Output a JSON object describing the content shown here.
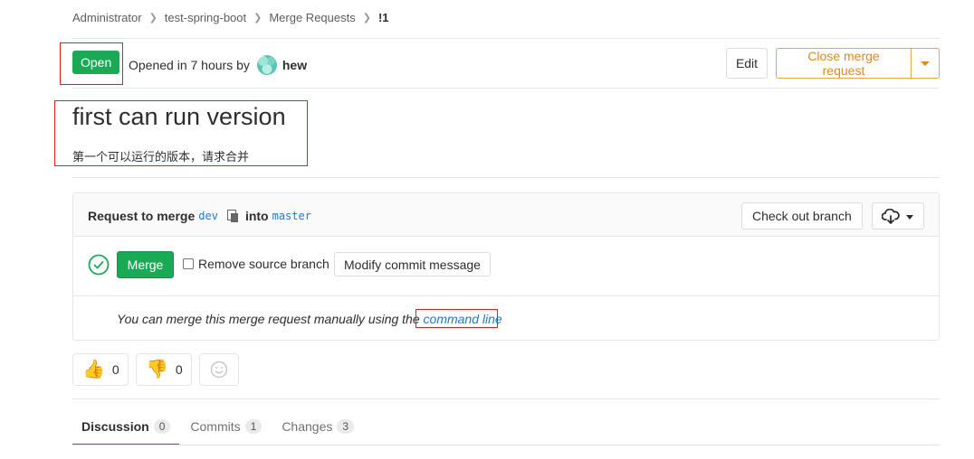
{
  "breadcrumb": [
    "Administrator",
    "test-spring-boot",
    "Merge Requests",
    "!1"
  ],
  "status": {
    "badge": "Open",
    "opened_text": "Opened in 7 hours by",
    "author": "hew"
  },
  "actions": {
    "edit": "Edit",
    "close": "Close merge request"
  },
  "merge_request": {
    "title": "first can run version",
    "description": "第一个可以运行的版本，请求合并"
  },
  "widget": {
    "request_label": "Request to merge",
    "source_branch": "dev",
    "into_label": "into",
    "target_branch": "master",
    "checkout_button": "Check out branch",
    "merge_button": "Merge",
    "remove_source_label": "Remove source branch",
    "modify_commit_button": "Modify commit message",
    "manual_text": "You can merge this merge request manually using the",
    "command_line_link": "command line"
  },
  "awards": {
    "thumbs_up": "0",
    "thumbs_down": "0"
  },
  "tabs": [
    {
      "label": "Discussion",
      "count": "0"
    },
    {
      "label": "Commits",
      "count": "1"
    },
    {
      "label": "Changes",
      "count": "3"
    }
  ],
  "colors": {
    "success": "#1aaa55",
    "warning": "#e08a1e",
    "link": "#1f78d1",
    "active_tab": "#6b4fbb",
    "annotation": "#e02020"
  }
}
